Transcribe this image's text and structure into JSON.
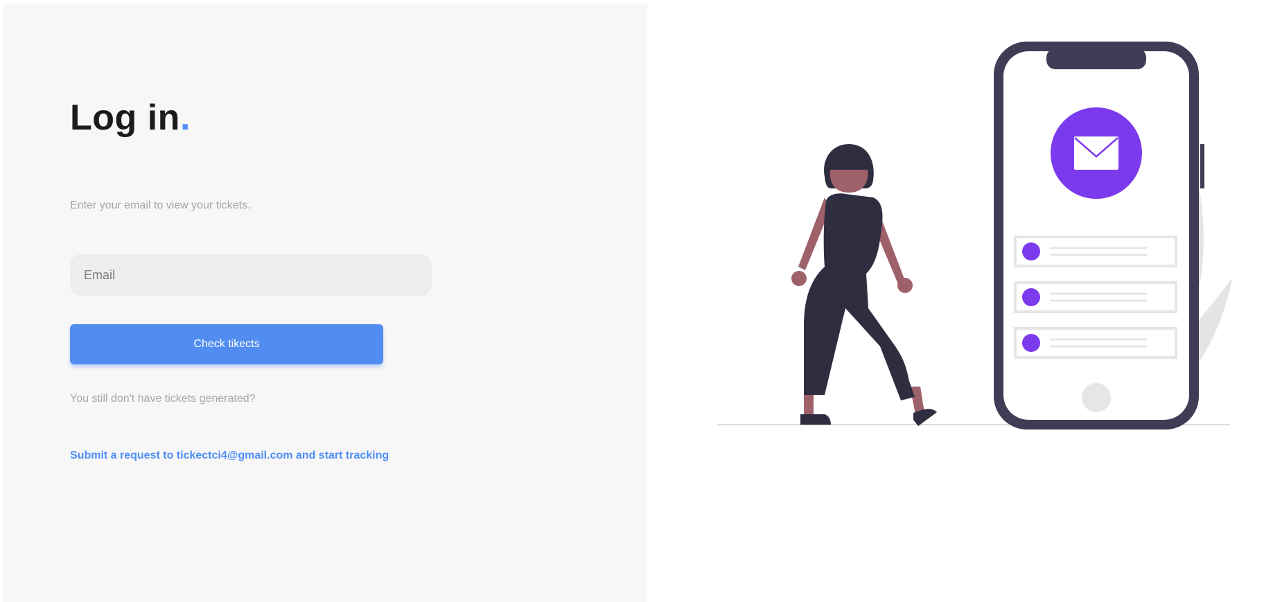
{
  "login": {
    "title": "Log in",
    "title_dot": ".",
    "subtitle": "Enter your email to view your tickets.",
    "email_placeholder": "Email",
    "email_value": "",
    "button_label": "Check tikects",
    "hint": "You still don't have tickets generated?",
    "link_text": "Submit a request to tickectci4@gmail.com and start tracking"
  },
  "colors": {
    "accent": "#4f8ef7",
    "button": "#518cf0",
    "panel": "#f7f7f7",
    "illustration_purple": "#7c3aed",
    "phone_frame": "#3f3d56"
  },
  "illustration": {
    "icons": [
      "woman-figure",
      "smartphone",
      "envelope-icon",
      "leaf-decoration"
    ]
  }
}
